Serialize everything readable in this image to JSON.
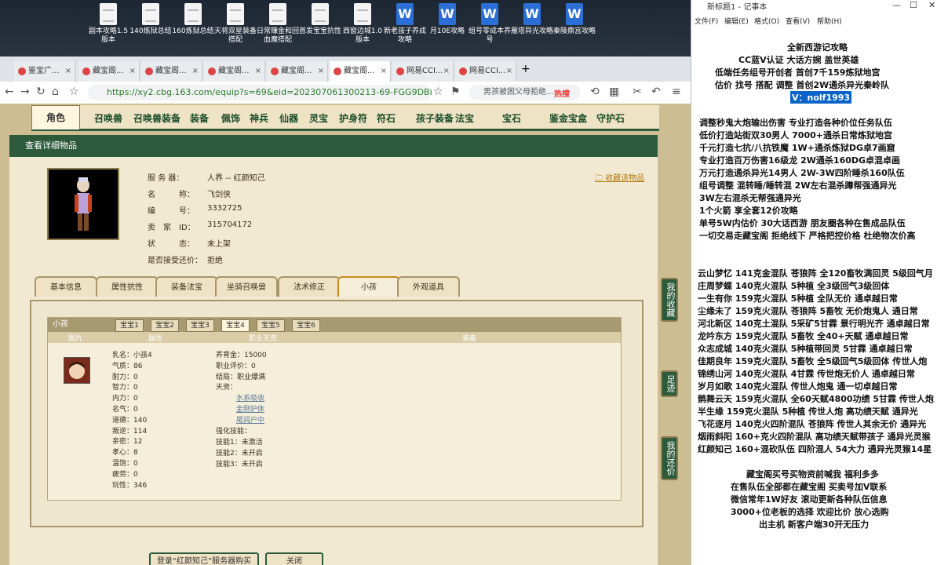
{
  "desktop": {
    "icons": [
      {
        "label": "副本攻略1.5版本",
        "type": "txt"
      },
      {
        "label": "140炼狱总结",
        "type": "txt"
      },
      {
        "label": "160炼狱总结",
        "type": "txt"
      },
      {
        "label": "天将双星装备搭配",
        "type": "txt"
      },
      {
        "label": "日常赚金和回血魔搭配",
        "type": "txt"
      },
      {
        "label": "首发宝宝抗性",
        "type": "txt"
      },
      {
        "label": "西窗边城1.0版本",
        "type": "txt"
      },
      {
        "label": "新老孩子养成攻略",
        "type": "word"
      },
      {
        "label": "月10E攻略",
        "type": "word"
      },
      {
        "label": "组号零成本养号",
        "type": "word"
      },
      {
        "label": "雁塔异光攻略",
        "type": "word"
      },
      {
        "label": "秦陵鼎宫攻略",
        "type": "word"
      }
    ]
  },
  "browser": {
    "tabs": [
      "鉴宝广...",
      "藏宝阁...",
      "藏宝阁...",
      "藏宝阁...",
      "藏宝阁...",
      "藏宝阁...",
      "网易CCI...",
      "网易CCI..."
    ],
    "url": "https://xy2.cbg.163.com/equip?s=69&eid=202307061300213-69-FGG9DBB3HTO7KS",
    "search_text": "男孩被困父母拒绝...",
    "hot_label": "热搜"
  },
  "cbg": {
    "top_tabs": [
      "角色",
      "召唤兽",
      "召唤兽装备",
      "装备",
      "佩饰",
      "神兵",
      "仙器",
      "灵宝",
      "护身符",
      "符石",
      "孩子装备",
      "法宝",
      "宝石",
      "鉴金宝盒",
      "守护石"
    ],
    "section_title": "查看详细物品",
    "collect_label": "收藏该物品",
    "info": [
      {
        "label": "服 务 器：",
        "value": "人界 -- 红颜知己"
      },
      {
        "label": "名　　　称：",
        "value": "飞剑侠"
      },
      {
        "label": "编　　　号：",
        "value": "3332725"
      },
      {
        "label": "卖　家　ID：",
        "value": "315704172"
      },
      {
        "label": "状　　　态：",
        "value": "未上架"
      },
      {
        "label": "是否接受还价：",
        "value": "拒绝"
      }
    ],
    "sub_tabs": [
      "基本信息",
      "属性抗性",
      "装备法宝",
      "坐骑召唤兽",
      "法术修正",
      "小孩",
      "外观道具"
    ],
    "active_sub_tab": "小孩",
    "child_panel_title": "小孩",
    "baby_tabs": [
      "宝宝1",
      "宝宝2",
      "宝宝3",
      "宝宝4",
      "宝宝5",
      "宝宝6"
    ],
    "active_baby": "宝宝4",
    "col_headers": [
      "图片",
      "属性",
      "职业天资",
      "装备"
    ],
    "child_stats": [
      "乳名：小孩4",
      "气质：86",
      "耐力：0",
      "智力：0",
      "内力：0",
      "名气：0",
      "道德：140",
      "叛逆：114",
      "亲密：12",
      "孝心：8",
      "温饱：0",
      "疲劳：0",
      "玩性：346"
    ],
    "child_right": [
      "养育金：15000",
      "职业评价：0",
      "结局：职业爆满",
      "天资："
    ],
    "talents": [
      "水系吸收",
      "金刚护体",
      "尾闾户中"
    ],
    "skills_title": "强化技能：",
    "skills": [
      "技能1：未激活",
      "技能2：未开启",
      "技能3：未开启"
    ],
    "bottom_buttons": [
      "登录“红颜知己”服务器购买",
      "关闭"
    ],
    "side_buttons": [
      "我的收藏",
      "足迹",
      "我的还价"
    ]
  },
  "notepad": {
    "title": "新标题1 - 记事本",
    "menu": [
      "文件(F)",
      "编辑(E)",
      "格式(O)",
      "查看(V)",
      "帮助(H)"
    ],
    "lines": [
      "全新西游记攻略",
      "CC蓝V认证  大话方婉 盖世英雄",
      "低端任务组号开创者          首创7千159炼狱地宫",
      "估价 找号 搭配 调整          首创2W通杀异光秦岭队",
      "V：nolf1993",
      "调整秒鬼大炮输出伤害          专业打造各种价位任务队伍",
      "低价打造站街双30男人           7000+通杀日常炼狱地宫",
      "千元打造七抗/八抗铁魔          1W+通杀炼狱DG卓7画窟",
      "专业打造百万伤害16级龙          2W通杀160DG卓混卓画",
      "万元打造通杀异光14男人         2W-3W四阶睡杀160队伍",
      "组号调整 混转睡/睡转混          2W左右混杀蹲帮强通异光",
      "                                    3W左右混杀无帮强通异光",
      "1个火箭 享全套12价攻略",
      "单号5W内估价 30大话西游        朋友圈各种在售成品队伍",
      "一切交易走藏宝阁 拒绝线下     严格把控价格 杜绝物次价高",
      "云山梦忆 141克金混队 苍狼阵 全120畜牧满回灵 5级回气月",
      "庄周梦蝶 140克火混队 5种植 全3级回气3级回体",
      "一生有你 159克火混队 5种植 全队无价 通卓越日常",
      "尘缘未了 159克火混队 苍狼阵 5畜牧 无价炮鬼人 通日常",
      "河北新区 140克土混队 5采矿5甘霖 景行明光齐 通卓越日常",
      "龙吟东方 159克火混队 5畜牧 全40+天赋 通卓越日常",
      "众志成城 140克火混队 5种植带回灵 5甘霖 通卓越日常",
      "佳期良年 159克火混队 5畜牧 全5级回气5级回体 传世人炮",
      "锦绣山河 140克火混队 4甘霖 传世炮无价人 通卓越日常",
      "岁月如歌 140克火混队 传世人炮鬼 通一切卓越日常",
      "鹊舞云天 159克火混队 全60天赋4800功绩 5甘霖 传世人炮",
      "半生缘   159克火混队 5种植 传世人炮 高功绩天赋 通异光",
      "飞花逐月 140克火四阶混队 苍狼阵 传世人其余无价 通异光",
      "烟雨斜阳 160+克火四阶混队 高功绩天赋带孩子 通异光灵猴",
      "红颜知己 160+混砍队伍 四阶混人 54大力 通异光灵猴14星",
      "藏宝阁买号买物资前喊我 福利多多",
      "在售队伍全部都在藏宝阁 买卖号加V联系",
      "微信常年1W好友 滚动更新各种队伍信息",
      "3000+位老板的选择 欢迎比价 放心选购",
      "出主机 新客户端30开无压力"
    ]
  }
}
